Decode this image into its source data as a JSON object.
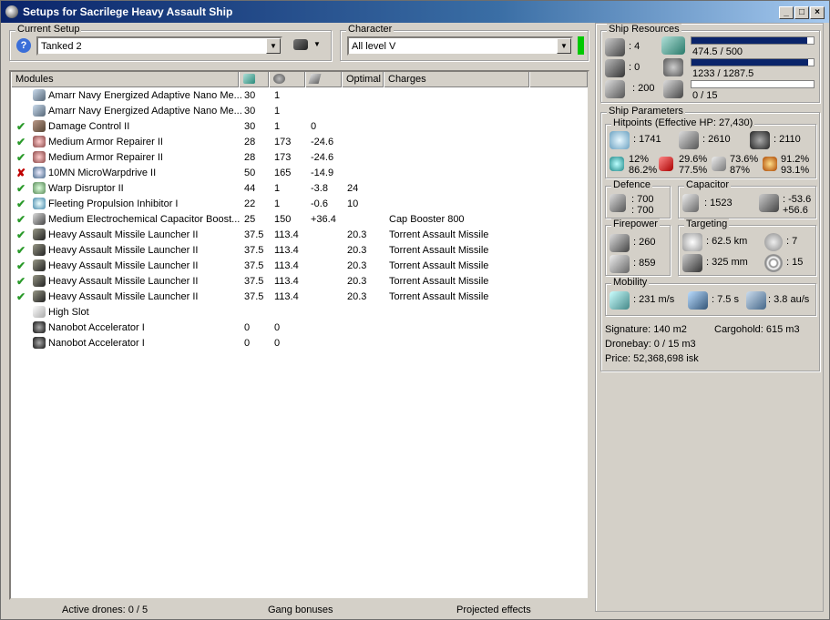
{
  "window": {
    "title": "Setups for Sacrilege Heavy Assault Ship",
    "min_label": "_",
    "max_label": "□",
    "close_label": "×"
  },
  "setup": {
    "label": "Current Setup",
    "value": "Tanked 2"
  },
  "character": {
    "label": "Character",
    "value": "All level V",
    "status_color": "#00c800"
  },
  "modules": {
    "headers": {
      "name": "Modules",
      "optimal": "Optimal",
      "charges": "Charges"
    },
    "rows": [
      {
        "status": "none",
        "icon": "nano-membrane-icon",
        "name": "Amarr Navy Energized Adaptive Nano Me...",
        "cpu": "30",
        "pg": "1",
        "cap": "",
        "optimal": "",
        "charge": ""
      },
      {
        "status": "none",
        "icon": "nano-membrane-icon",
        "name": "Amarr Navy Energized Adaptive Nano Me...",
        "cpu": "30",
        "pg": "1",
        "cap": "",
        "optimal": "",
        "charge": ""
      },
      {
        "status": "ok",
        "icon": "damage-control-icon",
        "name": "Damage Control II",
        "cpu": "30",
        "pg": "1",
        "cap": "0",
        "optimal": "",
        "charge": ""
      },
      {
        "status": "ok",
        "icon": "armor-repairer-icon",
        "name": "Medium Armor Repairer II",
        "cpu": "28",
        "pg": "173",
        "cap": "-24.6",
        "optimal": "",
        "charge": ""
      },
      {
        "status": "ok",
        "icon": "armor-repairer-icon",
        "name": "Medium Armor Repairer II",
        "cpu": "28",
        "pg": "173",
        "cap": "-24.6",
        "optimal": "",
        "charge": ""
      },
      {
        "status": "bad",
        "icon": "microwarpdrive-icon",
        "name": "10MN MicroWarpdrive II",
        "cpu": "50",
        "pg": "165",
        "cap": "-14.9",
        "optimal": "",
        "charge": ""
      },
      {
        "status": "ok",
        "icon": "warp-disruptor-icon",
        "name": "Warp Disruptor II",
        "cpu": "44",
        "pg": "1",
        "cap": "-3.8",
        "optimal": "24",
        "charge": ""
      },
      {
        "status": "ok",
        "icon": "stasis-web-icon",
        "name": "Fleeting Propulsion Inhibitor I",
        "cpu": "22",
        "pg": "1",
        "cap": "-0.6",
        "optimal": "10",
        "charge": ""
      },
      {
        "status": "ok",
        "icon": "cap-booster-icon",
        "name": "Medium Electrochemical Capacitor Boost...",
        "cpu": "25",
        "pg": "150",
        "cap": "+36.4",
        "optimal": "",
        "charge": "Cap Booster 800"
      },
      {
        "status": "ok",
        "icon": "missile-launcher-icon",
        "name": "Heavy Assault Missile Launcher II",
        "cpu": "37.5",
        "pg": "113.4",
        "cap": "",
        "optimal": "20.3",
        "charge": "Torrent Assault Missile"
      },
      {
        "status": "ok",
        "icon": "missile-launcher-icon",
        "name": "Heavy Assault Missile Launcher II",
        "cpu": "37.5",
        "pg": "113.4",
        "cap": "",
        "optimal": "20.3",
        "charge": "Torrent Assault Missile"
      },
      {
        "status": "ok",
        "icon": "missile-launcher-icon",
        "name": "Heavy Assault Missile Launcher II",
        "cpu": "37.5",
        "pg": "113.4",
        "cap": "",
        "optimal": "20.3",
        "charge": "Torrent Assault Missile"
      },
      {
        "status": "ok",
        "icon": "missile-launcher-icon",
        "name": "Heavy Assault Missile Launcher II",
        "cpu": "37.5",
        "pg": "113.4",
        "cap": "",
        "optimal": "20.3",
        "charge": "Torrent Assault Missile"
      },
      {
        "status": "ok",
        "icon": "missile-launcher-icon",
        "name": "Heavy Assault Missile Launcher II",
        "cpu": "37.5",
        "pg": "113.4",
        "cap": "",
        "optimal": "20.3",
        "charge": "Torrent Assault Missile"
      },
      {
        "status": "none",
        "icon": "high-slot-icon",
        "name": "High Slot",
        "cpu": "",
        "pg": "",
        "cap": "",
        "optimal": "",
        "charge": ""
      },
      {
        "status": "none",
        "icon": "drone-icon",
        "name": "Nanobot Accelerator I",
        "cpu": "0",
        "pg": "0",
        "cap": "",
        "optimal": "",
        "charge": ""
      },
      {
        "status": "none",
        "icon": "drone-icon",
        "name": "Nanobot Accelerator I",
        "cpu": "0",
        "pg": "0",
        "cap": "",
        "optimal": "",
        "charge": ""
      }
    ]
  },
  "statusbar": {
    "drones": "Active drones: 0 / 5",
    "gang": "Gang bonuses",
    "projected": "Projected effects"
  },
  "resources": {
    "label": "Ship Resources",
    "turret": ": 4",
    "launcher": ": 0",
    "calibration": ": 200",
    "cpu_text": "474.5 / 500",
    "cpu_fraction": 0.949,
    "pg_text": "1233 / 1287.5",
    "pg_fraction": 0.958,
    "drone_text": "0 / 15",
    "drone_fraction": 0
  },
  "params": {
    "label": "Ship Parameters",
    "hitpoints_label": "Hitpoints (Effective HP: 27,430)",
    "shield_hp": ": 1741",
    "armor_hp": ": 2610",
    "hull_hp": ": 2110",
    "shield_res_a": "12%",
    "shield_res_b": "86.2%",
    "armor_res_a": "29.6%",
    "armor_res_b": "77.5%",
    "kin_res_a": "73.6%",
    "kin_res_b": "87%",
    "exp_res_a": "91.2%",
    "exp_res_b": "93.1%",
    "defence_label": "Defence",
    "defence_a": ": 700",
    "defence_b": ": 700",
    "capacitor_label": "Capacitor",
    "cap_amount": ": 1523",
    "cap_delta_a": ": -53.6",
    "cap_delta_b": "+56.6",
    "firepower_label": "Firepower",
    "fire_a": ": 260",
    "fire_b": ": 859",
    "targeting_label": "Targeting",
    "target_range": ": 62.5 km",
    "target_count": ": 7",
    "scan_res": ": 325 mm",
    "sensor_str": ": 15",
    "mobility_label": "Mobility",
    "speed": ": 231 m/s",
    "align": ": 7.5 s",
    "warp": ": 3.8 au/s",
    "signature": "Signature: 140 m2",
    "cargohold": "Cargohold: 615 m3",
    "dronebay": "Dronebay: 0 / 15 m3",
    "price": "Price: 52,368,698 isk"
  }
}
